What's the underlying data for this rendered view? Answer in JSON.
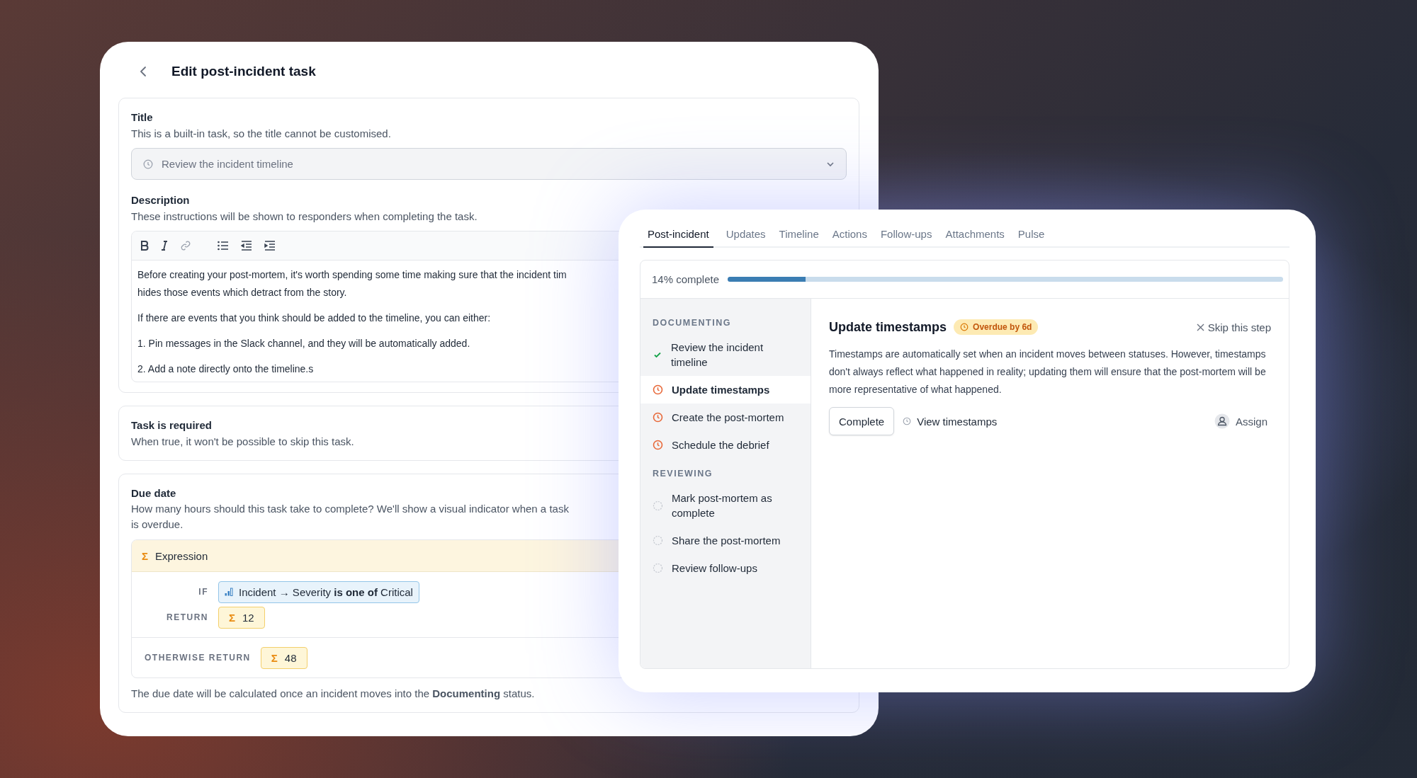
{
  "edit_task": {
    "title": "Edit post-incident task",
    "title_field": {
      "label": "Title",
      "hint": "This is a built-in task, so the title cannot be customised.",
      "value": "Review the incident timeline",
      "disabled": true
    },
    "description": {
      "label": "Description",
      "hint": "These instructions will be shown to responders when completing the task.",
      "paragraphs": [
        [
          "Before creating your post-mortem, it's worth spending some time making sure that the incident tim",
          "hides those events which detract from the story."
        ],
        [
          "If there are events that you think should be added to the timeline, you can either:"
        ],
        [
          "1. Pin messages in the Slack channel, and they will be automatically added."
        ],
        [
          "2. Add a note directly onto the timeline.s"
        ]
      ]
    },
    "required": {
      "label": "Task is required",
      "hint": "When true, it won't be possible to skip this task."
    },
    "due_date": {
      "label": "Due date",
      "hint": "How many hours should this task take to complete? We'll show a visual indicator when a task is overdue.",
      "expression": {
        "symbol": "Σ",
        "label": "Expression",
        "if_label": "IF",
        "condition": "Incident → Severity **is one of** Critical",
        "return_label": "RETURN",
        "return_symbol": "Σ",
        "return_value": "12",
        "otherwise_label": "OTHERWISE RETURN",
        "otherwise_symbol": "Σ",
        "otherwise_value": "48"
      },
      "note": "The due date will be calculated once an incident moves into the **Documenting** status."
    }
  },
  "incident": {
    "tabs": [
      {
        "label": "Post-incident",
        "selected": true
      },
      {
        "label": "Updates",
        "selected": false
      },
      {
        "label": "Timeline",
        "selected": false
      },
      {
        "label": "Actions",
        "selected": false
      },
      {
        "label": "Follow-ups",
        "selected": false
      },
      {
        "label": "Attachments",
        "selected": false
      },
      {
        "label": "Pulse",
        "selected": false
      }
    ],
    "progress": {
      "label": "14% complete",
      "level": 0.14
    },
    "groups": [
      {
        "heading": "DOCUMENTING",
        "steps": [
          {
            "label": "Review the incident timeline",
            "kind": "done",
            "selected": false
          },
          {
            "label": "Update timestamps",
            "kind": "overdue",
            "selected": true
          },
          {
            "label": "Create the post-mortem",
            "kind": "overdue",
            "selected": false
          },
          {
            "label": "Schedule the debrief",
            "kind": "overdue",
            "selected": false
          }
        ]
      },
      {
        "heading": "REVIEWING",
        "steps": [
          {
            "label": "Mark post-mortem as complete",
            "kind": "pending",
            "selected": false
          },
          {
            "label": "Share the post-mortem",
            "kind": "pending",
            "selected": false
          },
          {
            "label": "Review follow-ups",
            "kind": "pending",
            "selected": false
          }
        ]
      }
    ],
    "detail": {
      "title": "Update timestamps",
      "badge": "Overdue by 6d",
      "skip": "Skip this step",
      "text": "Timestamps are automatically set when an incident moves between statuses. However, timestamps don't always reflect what happened in reality; updating them will ensure that the post-mortem will be more representative of what happened.",
      "complete": "Complete",
      "view": "View timestamps",
      "assign": "Assign"
    }
  }
}
